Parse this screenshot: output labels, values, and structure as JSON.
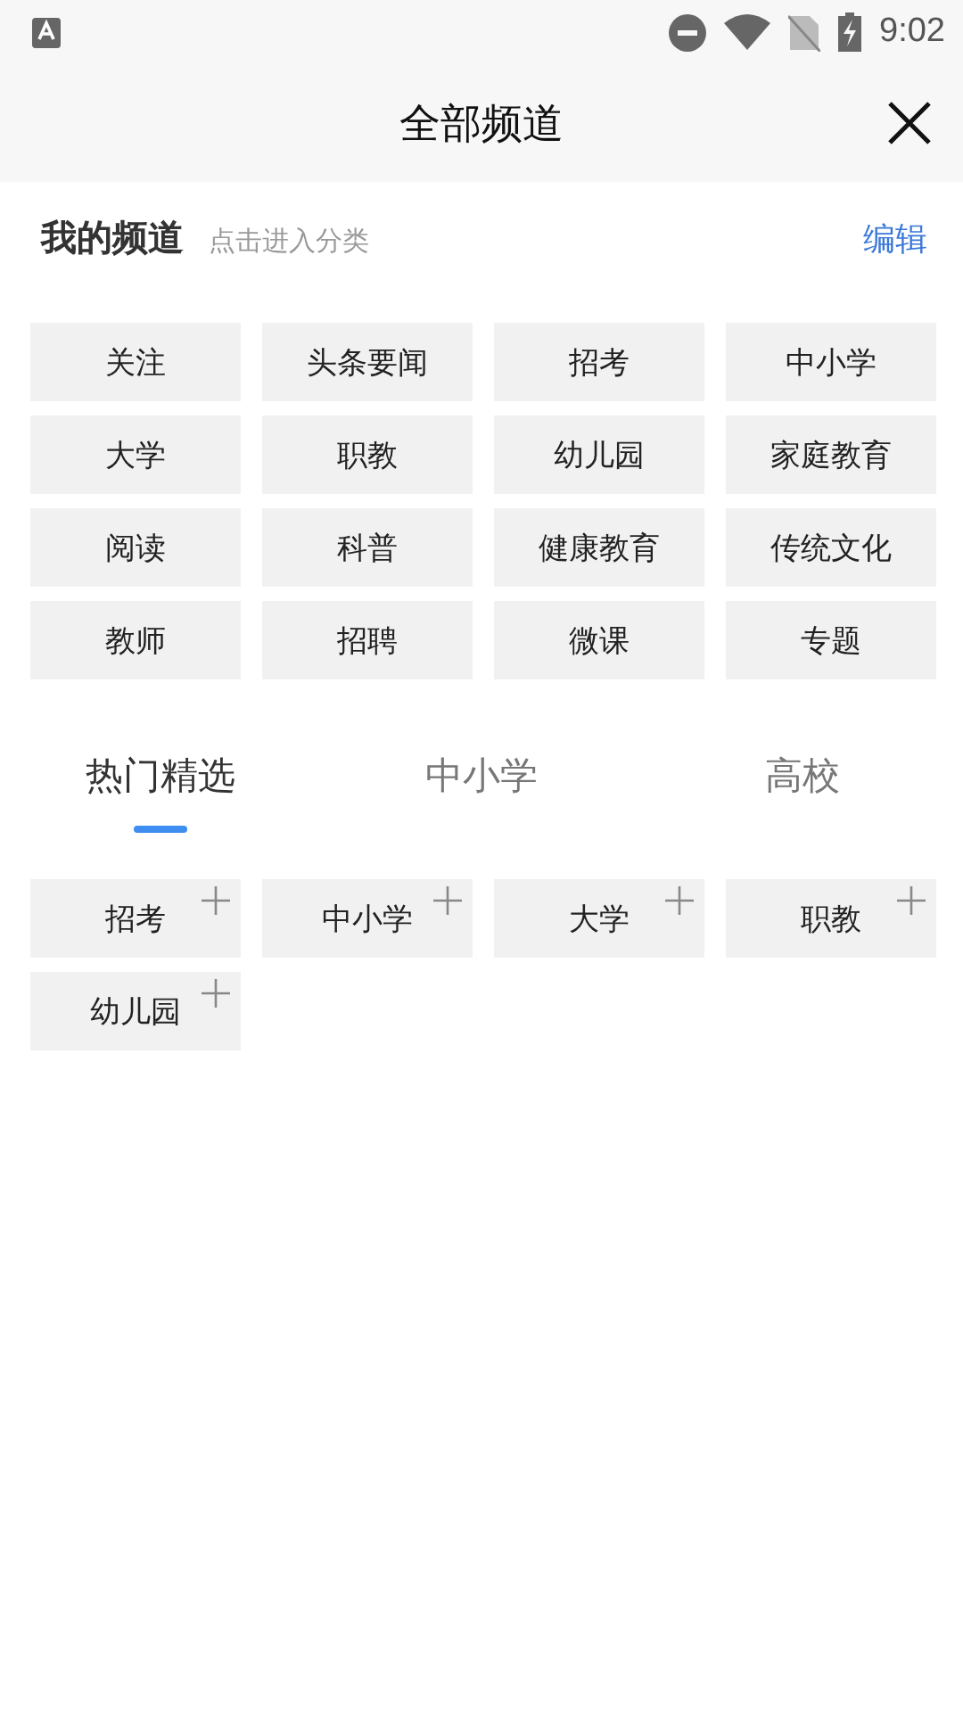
{
  "status_bar": {
    "time": "9:02"
  },
  "header": {
    "title": "全部频道"
  },
  "my_channels": {
    "title": "我的频道",
    "hint": "点击进入分类",
    "edit": "编辑",
    "items": [
      "关注",
      "头条要闻",
      "招考",
      "中小学",
      "大学",
      "职教",
      "幼儿园",
      "家庭教育",
      "阅读",
      "科普",
      "健康教育",
      "传统文化",
      "教师",
      "招聘",
      "微课",
      "专题"
    ]
  },
  "tabs": [
    {
      "label": "热门精选",
      "selected": true
    },
    {
      "label": "中小学",
      "selected": false
    },
    {
      "label": "高校",
      "selected": false
    }
  ],
  "recommended": [
    "招考",
    "中小学",
    "大学",
    "职教",
    "幼儿园"
  ]
}
